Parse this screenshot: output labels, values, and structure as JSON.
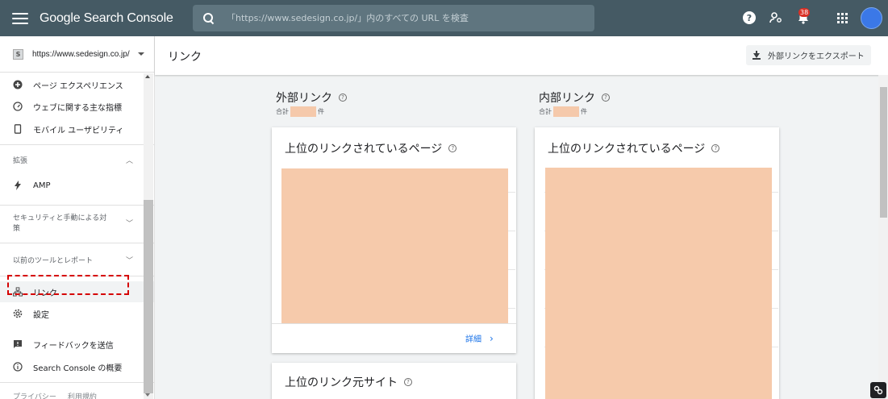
{
  "topbar": {
    "brand": "Google Search Console",
    "search_placeholder": "「https://www.sedesign.co.jp/」内のすべての URL を検査",
    "notification_count": "38"
  },
  "sidebar": {
    "property_icon": "S",
    "property_url": "https://www.sedesign.co.jp/",
    "items_top": [
      {
        "label": "ページ エクスペリエンス",
        "icon": "plus-circle-icon"
      },
      {
        "label": "ウェブに関する主な指標",
        "icon": "gauge-icon"
      },
      {
        "label": "モバイル ユーザビリティ",
        "icon": "phone-icon"
      }
    ],
    "section_enhancements": "拡張",
    "amp_label": "AMP",
    "section_security": "セキュリティと手動による対策",
    "section_legacy": "以前のツールとレポート",
    "links_label": "リンク",
    "settings_label": "設定",
    "feedback_label": "フィードバックを送信",
    "about_label": "Search Console の概要",
    "footer_privacy": "プライバシー",
    "footer_terms": "利用規約"
  },
  "header": {
    "title": "リンク",
    "export_label": "外部リンクをエクスポート"
  },
  "external": {
    "title": "外部リンク",
    "total_prefix": "合計",
    "total_suffix": "件",
    "card_top_pages": "上位のリンクされているページ",
    "details_label": "詳細",
    "card_top_sites": "上位のリンク元サイト"
  },
  "internal": {
    "title": "内部リンク",
    "total_prefix": "合計",
    "total_suffix": "件",
    "card_top_pages": "上位のリンクされているページ"
  },
  "colors": {
    "topbar": "#455a64",
    "redaction": "#f6caab",
    "link": "#1a73e8",
    "highlight": "#d50000"
  }
}
